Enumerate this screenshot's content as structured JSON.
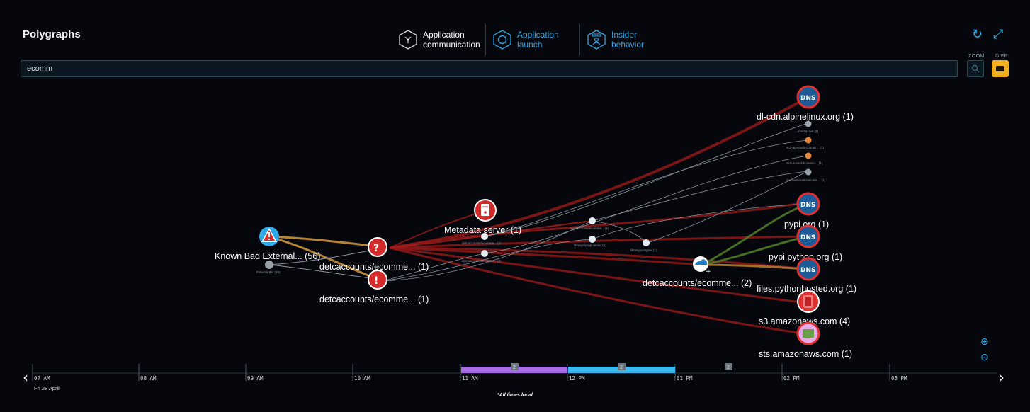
{
  "header": {
    "title": "Polygraphs",
    "tabs": [
      {
        "line1": "Application",
        "line2": "communication",
        "icon": "network-icon"
      },
      {
        "line1": "Application",
        "line2": "launch",
        "icon": "launch-icon"
      },
      {
        "line1": "Insider",
        "line2": "behavior",
        "icon": "user-icon"
      }
    ],
    "refresh_icon": "refresh-icon",
    "expand_icon": "expand-icon"
  },
  "controls": {
    "zoom_label": "ZOOM",
    "diff_label": "DIFF"
  },
  "search": {
    "value": "ecomm"
  },
  "graph": {
    "nodes": {
      "known_bad": "Known Bad External... (56)",
      "external_ips": "External IPs (35)",
      "detc_1": "detcaccounts/ecomme... (1)",
      "detc_2": "detcaccounts/ecomme... (1)",
      "metadata": "Metadata server (1)",
      "detc_docker": "detcaccounts/ecomme... (2)",
      "dl_cdn": "dl-cdn.alpinelinux.org (1)",
      "pypi": "pypi.org (1)",
      "pypi_python": "pypi.python.org (1)",
      "files_py": "files.pythonhosted.org (1)",
      "s3": "s3.amazonaws.com (4)",
      "sts": "sts.amazonaws.com (1)",
      "small_1": "...oraidap.net (2)",
      "small_2": "ec2-ap-south-1.amaz... (1)",
      "small_3": "ecr.us-east-2.amazo... (1)",
      "small_4": "2n1ea8secr8.execute-... (1)",
      "mid_1": "detcaccounts/ecomme... (1)",
      "mid_2": "detcaccounts/ecomme... (1)",
      "mid_3": "detcaccounts/ecomme... (1)",
      "mid_4": "detcaccounts/ecomme... (1)",
      "mid_5": "library/mysql server (1)",
      "mid_6": "library/postgres (1)"
    },
    "colors": {
      "danger": "#d42a2a",
      "edge_red": "#9a1a1a",
      "edge_gold": "#c9913a",
      "edge_green": "#5c8a2a",
      "edge_gray": "#8a939c",
      "dns_ring": "#e03030",
      "dns_fill": "#1d5b98"
    }
  },
  "timeline": {
    "ticks": [
      "07 AM",
      "08 AM",
      "09 AM",
      "10 AM",
      "11 AM",
      "12 PM",
      "01 PM",
      "02 PM",
      "03 PM"
    ],
    "date": "Fri 28 April",
    "badges": [
      "2",
      "2",
      "2"
    ],
    "note": "*All times local",
    "segment_colors": [
      "#a66ee6",
      "#3ab8ef"
    ]
  }
}
